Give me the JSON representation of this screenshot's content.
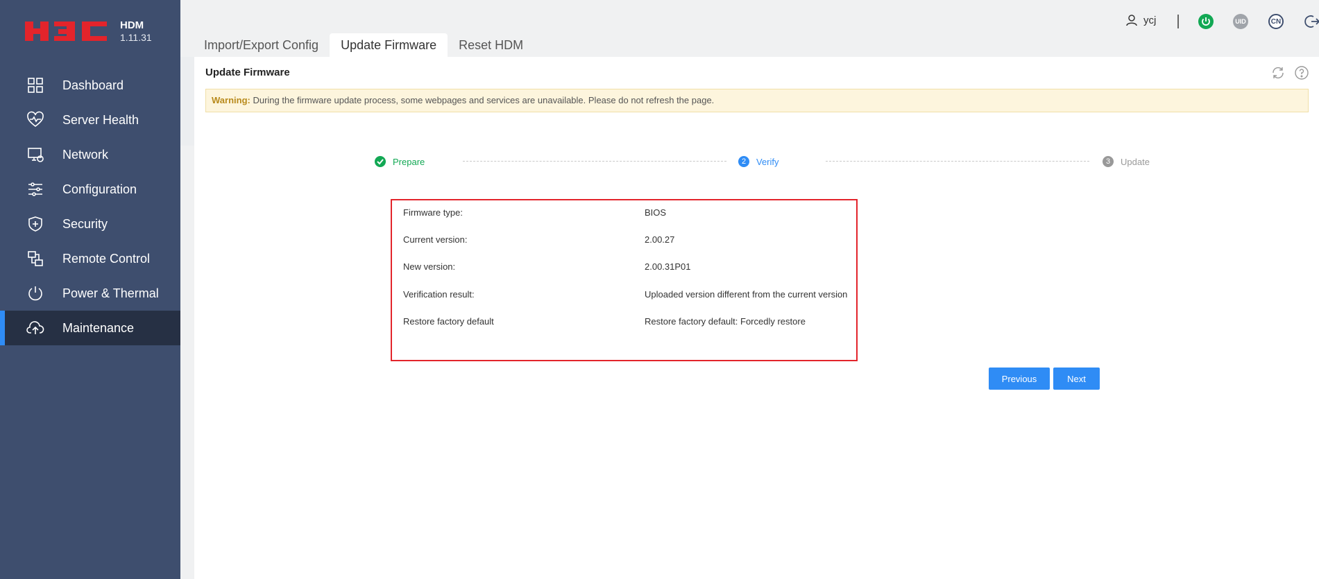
{
  "brand": {
    "logo_text": "H3C",
    "product": "HDM",
    "version": "1.11.31"
  },
  "sidebar": {
    "items": [
      {
        "label": "Dashboard",
        "icon": "dashboard-icon"
      },
      {
        "label": "Server Health",
        "icon": "heart-icon"
      },
      {
        "label": "Network",
        "icon": "network-icon"
      },
      {
        "label": "Configuration",
        "icon": "sliders-icon"
      },
      {
        "label": "Security",
        "icon": "shield-icon"
      },
      {
        "label": "Remote Control",
        "icon": "remote-icon"
      },
      {
        "label": "Power & Thermal",
        "icon": "power-icon"
      },
      {
        "label": "Maintenance",
        "icon": "cloud-upload-icon",
        "active": true
      }
    ]
  },
  "topbar": {
    "username": "ycj",
    "uid_label": "UID",
    "lang_label": "CN"
  },
  "tabs": [
    {
      "label": "Import/Export Config"
    },
    {
      "label": "Update Firmware",
      "active": true
    },
    {
      "label": "Reset HDM"
    }
  ],
  "panel": {
    "title": "Update Firmware",
    "warning_label": "Warning:",
    "warning_text": " During the firmware update process, some webpages and services are unavailable. Please do not refresh the page."
  },
  "steps": [
    {
      "number": "1",
      "label": "Prepare",
      "state": "done"
    },
    {
      "number": "2",
      "label": "Verify",
      "state": "current"
    },
    {
      "number": "3",
      "label": "Update",
      "state": "pending"
    }
  ],
  "info": {
    "rows": [
      {
        "key": "Firmware type:",
        "value": "BIOS"
      },
      {
        "key": "Current version:",
        "value": "2.00.27"
      },
      {
        "key": "New version:",
        "value": "2.00.31P01"
      },
      {
        "key": "Verification result:",
        "value": "Uploaded version different from the current version"
      },
      {
        "key": "Restore factory default",
        "value": "Restore factory default: Forcedly restore"
      }
    ]
  },
  "buttons": {
    "previous": "Previous",
    "next": "Next"
  },
  "colors": {
    "sidebar": "#3e4e6e",
    "accent": "#2f8cf5",
    "success": "#12a854",
    "highlight": "#e3242b"
  }
}
